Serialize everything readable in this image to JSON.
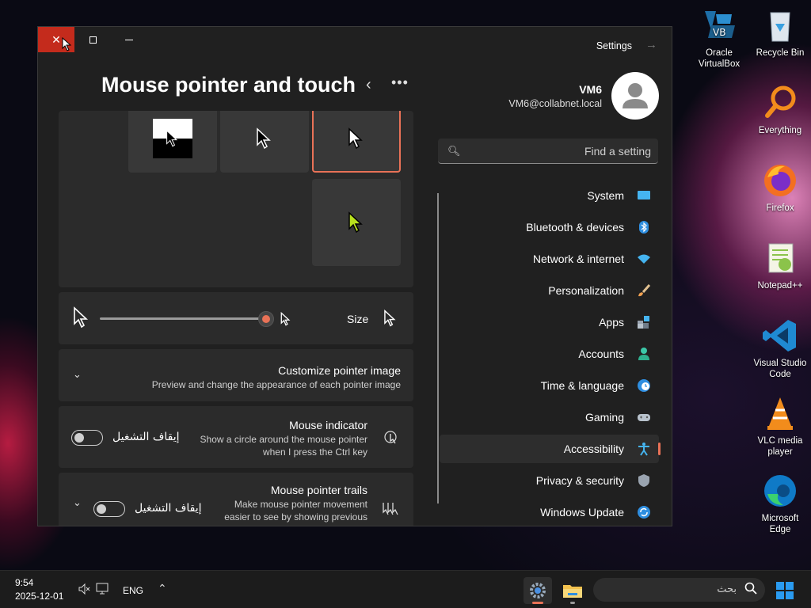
{
  "desktop": {
    "icons": [
      {
        "label": "Oracle VirtualBox",
        "icon": "virtualbox-icon"
      },
      {
        "label": "Recycle Bin",
        "icon": "recycle-bin-icon"
      },
      {
        "label": "Everything",
        "icon": "everything-icon"
      },
      {
        "label": "Firefox",
        "icon": "firefox-icon"
      },
      {
        "label": "Notepad++",
        "icon": "notepadpp-icon"
      },
      {
        "label": "Visual Studio Code",
        "icon": "vscode-icon"
      },
      {
        "label": "VLC media player",
        "icon": "vlc-icon"
      },
      {
        "label": "Microsoft Edge",
        "icon": "edge-icon"
      }
    ]
  },
  "window": {
    "app_title": "Settings",
    "page_title": "Mouse pointer and touch",
    "user": {
      "name": "VM6",
      "email": "VM6@collabnet.local"
    },
    "search_placeholder": "Find a setting",
    "nav": [
      {
        "label": "System",
        "icon": "system-icon",
        "active": false
      },
      {
        "label": "Bluetooth & devices",
        "icon": "bluetooth-icon",
        "active": false
      },
      {
        "label": "Network & internet",
        "icon": "wifi-icon",
        "active": false
      },
      {
        "label": "Personalization",
        "icon": "brush-icon",
        "active": false
      },
      {
        "label": "Apps",
        "icon": "apps-icon",
        "active": false
      },
      {
        "label": "Accounts",
        "icon": "accounts-icon",
        "active": false
      },
      {
        "label": "Time & language",
        "icon": "globe-clock-icon",
        "active": false
      },
      {
        "label": "Gaming",
        "icon": "gamepad-icon",
        "active": false
      },
      {
        "label": "Accessibility",
        "icon": "accessibility-icon",
        "active": true
      },
      {
        "label": "Privacy & security",
        "icon": "shield-icon",
        "active": false
      },
      {
        "label": "Windows Update",
        "icon": "update-icon",
        "active": false
      }
    ],
    "size_label": "Size",
    "size_level": 1.0,
    "customize": {
      "title": "Customize pointer image",
      "desc": "Preview and change the appearance of each pointer image"
    },
    "indicator": {
      "title": "Mouse indicator",
      "desc1": "Show a circle around the mouse pointer",
      "desc2": "when I press the Ctrl key",
      "toggle_label": "إيقاف التشغيل",
      "toggle_on": false
    },
    "trails": {
      "title": "Mouse pointer trails",
      "desc1": "Make mouse pointer movement",
      "desc2": "easier to see by showing previous",
      "toggle_label": "إيقاف التشغيل",
      "toggle_on": false
    },
    "colors": {
      "accent": "#e97257",
      "custom_pointer": "#b8e01e"
    }
  },
  "taskbar": {
    "time": "9:54",
    "date": "2025-12-01",
    "language": "ENG",
    "search_placeholder": "بحث"
  }
}
